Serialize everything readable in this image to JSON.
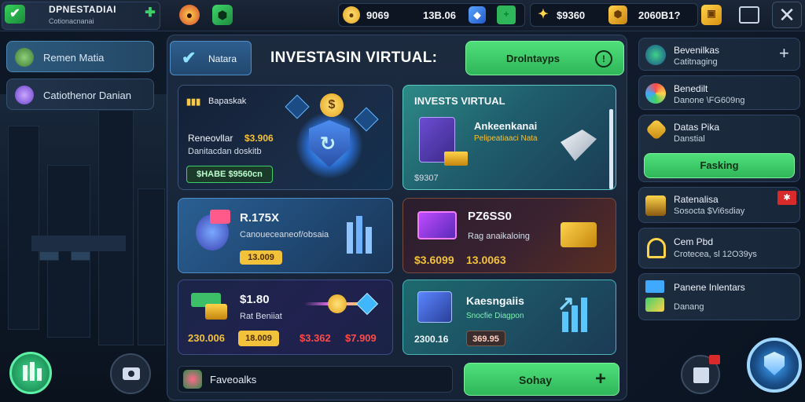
{
  "header": {
    "title": "DPNESTADIAI",
    "subtitle": "Cotionacnanai",
    "resources": [
      {
        "icon": "coin-icon",
        "value": "9069"
      },
      {
        "icon": "gem-value",
        "value": "13B.06"
      },
      {
        "icon": "star-coin-icon",
        "value": "$9360"
      },
      {
        "icon": "gold-hex-icon",
        "value": "2060B1?"
      }
    ],
    "close_label": "✕"
  },
  "sidebar": {
    "items": [
      {
        "label": "Remen Matia"
      },
      {
        "label": "Catiothenor Danian"
      }
    ]
  },
  "main": {
    "tab_label": "Natara",
    "title": "INVESTASIN VIRTUAL:",
    "top_button": "Drolntayps",
    "cards": {
      "featured": {
        "header": "Bapaskak",
        "line1_label": "Reneovllar",
        "line1_value": "$3.906",
        "line2": "Danitacdan doskitb",
        "badge": "$HABE $9560cn"
      },
      "invest": {
        "header": "INVESTS VIRTUAL",
        "item_title": "Ankeenkanai",
        "item_sub": "Pelipeatiaaci Nata",
        "value": "$9307"
      },
      "r1": {
        "title": "R.175X",
        "sub": "Canoueceaneof/obsaia",
        "price": "13.009"
      },
      "r2": {
        "title": "PZ6SS0",
        "sub": "Rag anaikaloing",
        "value1": "$3.6099",
        "value2": "13.0063"
      },
      "r3": {
        "title": "$1.80",
        "sub": "Rat Beniiat",
        "value1": "230.006",
        "value2": "18.009",
        "value3": "$3.362",
        "value4": "$7.909"
      },
      "r4": {
        "title": "Kaesngaiis",
        "sub": "Snocfie Diagpon",
        "value1": "2300.16",
        "value2": "369.95"
      }
    },
    "bottom_label": "Faveoalks",
    "bottom_button": "Sohay"
  },
  "right_panel": {
    "items": [
      {
        "title": "Bevenilkas",
        "sub": "Catitnaging"
      },
      {
        "title": "Benedilt",
        "sub": "Danone \\FG609ng"
      },
      {
        "title": "Datas Pika",
        "sub": "Danstial",
        "button": "Fasking"
      },
      {
        "title": "Ratenalisa",
        "sub": "Sosocta $Vi6sdiay"
      },
      {
        "title": "Cem Pbd",
        "sub": "Crotecea, sl 12O39ys"
      },
      {
        "title": "Panene Inlentars",
        "sub": "Danang"
      }
    ]
  },
  "colors": {
    "accent_green": "#3ccf6a",
    "price_red": "#ff4a4a",
    "price_gold": "#f2c23a"
  }
}
